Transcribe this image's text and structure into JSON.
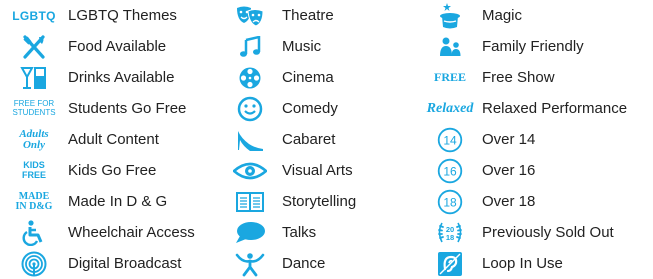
{
  "columns": [
    {
      "items": [
        {
          "label": "LGBTQ Themes",
          "icon": "lgbtq-icon",
          "icon_text": "LGBTQ"
        },
        {
          "label": "Food Available",
          "icon": "cutlery-icon"
        },
        {
          "label": "Drinks Available",
          "icon": "drinks-icon"
        },
        {
          "label": "Students Go Free",
          "icon": "free-for-students-icon",
          "icon_text": "FREE FOR STUDENTS"
        },
        {
          "label": "Adult Content",
          "icon": "adults-only-icon",
          "icon_text": "Adults Only"
        },
        {
          "label": "Kids Go Free",
          "icon": "kids-free-icon",
          "icon_text": "KIDS FREE"
        },
        {
          "label": "Made In D & G",
          "icon": "made-in-dg-icon",
          "icon_text": "MADE IN D&G"
        },
        {
          "label": "Wheelchair Access",
          "icon": "wheelchair-icon"
        },
        {
          "label": "Digital Broadcast",
          "icon": "broadcast-icon"
        }
      ]
    },
    {
      "items": [
        {
          "label": "Theatre",
          "icon": "theatre-masks-icon"
        },
        {
          "label": "Music",
          "icon": "music-note-icon"
        },
        {
          "label": "Cinema",
          "icon": "film-reel-icon"
        },
        {
          "label": "Comedy",
          "icon": "smiley-icon"
        },
        {
          "label": "Cabaret",
          "icon": "high-heel-icon"
        },
        {
          "label": "Visual Arts",
          "icon": "eye-icon"
        },
        {
          "label": "Storytelling",
          "icon": "open-book-icon"
        },
        {
          "label": "Talks",
          "icon": "speech-bubble-icon"
        },
        {
          "label": "Dance",
          "icon": "dancer-icon"
        }
      ]
    },
    {
      "items": [
        {
          "label": "Magic",
          "icon": "magic-hat-icon"
        },
        {
          "label": "Family Friendly",
          "icon": "family-icon"
        },
        {
          "label": "Free Show",
          "icon": "free-icon",
          "icon_text": "FREE"
        },
        {
          "label": "Relaxed Performance",
          "icon": "relaxed-icon",
          "icon_text": "Relaxed"
        },
        {
          "label": "Over 14",
          "icon": "age-14-icon",
          "icon_text": "14"
        },
        {
          "label": "Over 16",
          "icon": "age-16-icon",
          "icon_text": "16"
        },
        {
          "label": "Over 18",
          "icon": "age-18-icon",
          "icon_text": "18"
        },
        {
          "label": "Previously Sold Out",
          "icon": "laurel-icon",
          "icon_text": "20 18"
        },
        {
          "label": "Loop In Use",
          "icon": "hearing-loop-icon"
        }
      ]
    }
  ],
  "icon_color": "#1aa7e0",
  "text_color": "#222222"
}
